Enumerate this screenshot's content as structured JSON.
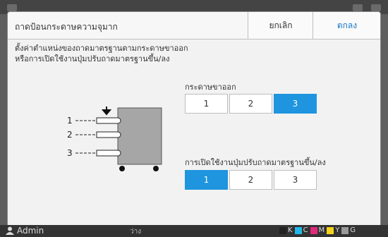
{
  "dialog": {
    "title": "ถาดป้อนกระดาษความจุมาก",
    "cancel_label": "ยกเลิก",
    "ok_label": "ตกลง",
    "description_line1": "ตั้งค่าตำแหน่งของถาดมาตรฐานตามกระดาษขาออก",
    "description_line2": "หรือการเปิดใช้งานปุ่มปรับถาดมาตรฐานขึ้น/ลง"
  },
  "diagram": {
    "labels": [
      "1",
      "2",
      "3"
    ]
  },
  "paper_output": {
    "label": "กระดาษขาออก",
    "options": [
      "1",
      "2",
      "3"
    ],
    "selected": "3"
  },
  "updown": {
    "label": "การเปิดใช้งานปุ่มปรับถาดมาตรฐานขึ้น/ลง",
    "options": [
      "1",
      "2",
      "3"
    ],
    "selected": "1"
  },
  "status_bar": {
    "user": "Admin",
    "status": "ว่าง",
    "inks": [
      {
        "letter": "K",
        "color": "#222222"
      },
      {
        "letter": "C",
        "color": "#22b7e8"
      },
      {
        "letter": "M",
        "color": "#e0297a"
      },
      {
        "letter": "Y",
        "color": "#f4d21c"
      },
      {
        "letter": "G",
        "color": "#9a9a9a"
      }
    ]
  }
}
